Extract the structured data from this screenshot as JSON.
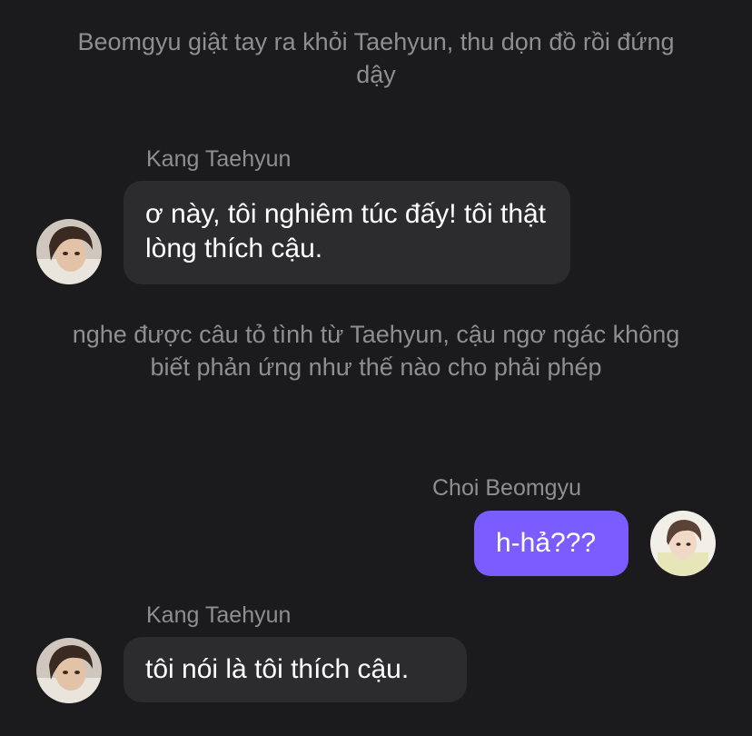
{
  "chat": {
    "narration_1": "Beomgyu giật tay ra khỏi Taehyun, thu dọn đồ rồi đứng dậy",
    "message_1": {
      "sender": "Kang Taehyun",
      "text": "ơ này, tôi nghiêm túc đấy! tôi thật lòng thích cậu."
    },
    "narration_2": "nghe được câu tỏ tình từ Taehyun, cậu ngơ ngác không biết phản ứng như thế nào cho phải phép",
    "message_2": {
      "sender": "Choi Beomgyu",
      "text": "h-hả???"
    },
    "message_3": {
      "sender": "Kang Taehyun",
      "text": "tôi nói là tôi thích cậu."
    }
  },
  "colors": {
    "background": "#1b1b1e",
    "incoming_bubble": "#2c2c2e",
    "outgoing_bubble": "#7b5cff",
    "secondary_text": "#8e8e93",
    "primary_text": "#ffffff"
  },
  "icons": {
    "taehyun_avatar": "avatar-photo",
    "beomgyu_avatar": "avatar-photo"
  }
}
